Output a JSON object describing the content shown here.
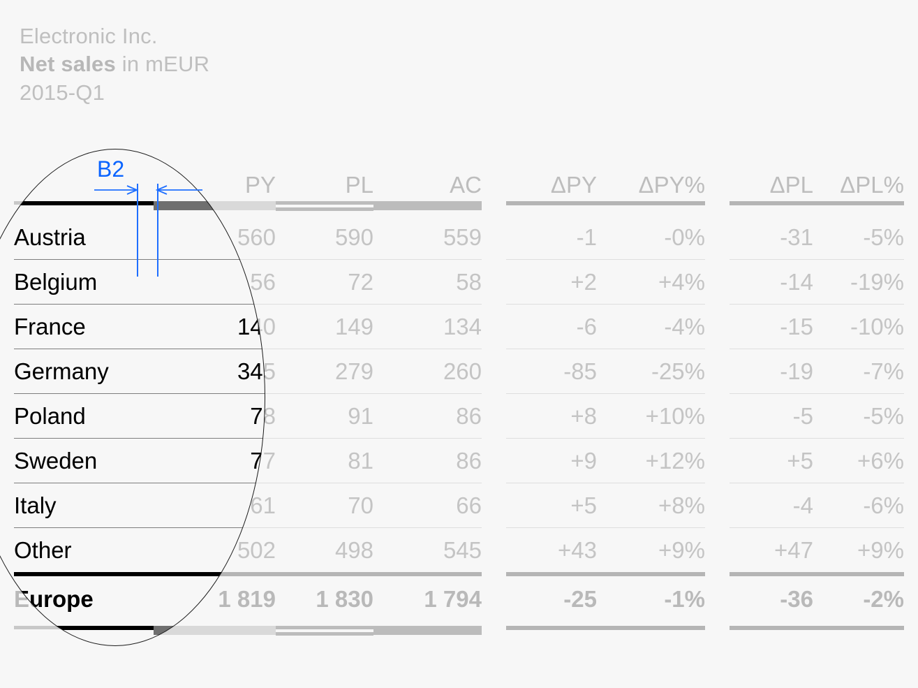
{
  "title": {
    "company": "Electronic Inc.",
    "measure_strong": "Net sales",
    "measure_rest": " in mEUR",
    "period": "2015-Q1"
  },
  "annotation": {
    "label": "B2",
    "color": "#0a64ff",
    "kind": "dimension-gap"
  },
  "table": {
    "headers": {
      "label": "",
      "py": "PY",
      "pl": "PL",
      "ac": "AC",
      "dpy": "ΔPY",
      "dpy_pct": "ΔPY%",
      "dpl": "ΔPL",
      "dpl_pct": "ΔPL%"
    },
    "rows": [
      {
        "label": "Austria",
        "py": "560",
        "pl": "590",
        "ac": "559",
        "dpy": "-1",
        "dpy_pct": "-0%",
        "dpl": "-31",
        "dpl_pct": "-5%"
      },
      {
        "label": "Belgium",
        "py": "56",
        "pl": "72",
        "ac": "58",
        "dpy": "+2",
        "dpy_pct": "+4%",
        "dpl": "-14",
        "dpl_pct": "-19%"
      },
      {
        "label": "France",
        "py": "140",
        "pl": "149",
        "ac": "134",
        "dpy": "-6",
        "dpy_pct": "-4%",
        "dpl": "-15",
        "dpl_pct": "-10%"
      },
      {
        "label": "Germany",
        "py": "345",
        "pl": "279",
        "ac": "260",
        "dpy": "-85",
        "dpy_pct": "-25%",
        "dpl": "-19",
        "dpl_pct": "-7%"
      },
      {
        "label": "Poland",
        "py": "78",
        "pl": "91",
        "ac": "86",
        "dpy": "+8",
        "dpy_pct": "+10%",
        "dpl": "-5",
        "dpl_pct": "-5%"
      },
      {
        "label": "Sweden",
        "py": "77",
        "pl": "81",
        "ac": "86",
        "dpy": "+9",
        "dpy_pct": "+12%",
        "dpl": "+5",
        "dpl_pct": "+6%"
      },
      {
        "label": "Italy",
        "py": "61",
        "pl": "70",
        "ac": "66",
        "dpy": "+5",
        "dpy_pct": "+8%",
        "dpl": "-4",
        "dpl_pct": "-6%"
      },
      {
        "label": "Other",
        "py": "502",
        "pl": "498",
        "ac": "545",
        "dpy": "+43",
        "dpy_pct": "+9%",
        "dpl": "+47",
        "dpl_pct": "+9%"
      }
    ],
    "total": {
      "label": "Europe",
      "py": "1 819",
      "pl": "1 830",
      "ac": "1 794",
      "dpy": "-25",
      "dpy_pct": "-1%",
      "dpl": "-36",
      "dpl_pct": "-2%"
    }
  },
  "chart_data": {
    "type": "table",
    "title": "Electronic Inc. — Net sales in mEUR — 2015-Q1",
    "categories": [
      "Austria",
      "Belgium",
      "France",
      "Germany",
      "Poland",
      "Sweden",
      "Italy",
      "Other",
      "Europe"
    ],
    "series": [
      {
        "name": "PY",
        "values": [
          560,
          56,
          140,
          345,
          78,
          77,
          61,
          502,
          1819
        ]
      },
      {
        "name": "PL",
        "values": [
          590,
          72,
          149,
          279,
          91,
          81,
          70,
          498,
          1830
        ]
      },
      {
        "name": "AC",
        "values": [
          559,
          58,
          134,
          260,
          86,
          86,
          66,
          545,
          1794
        ]
      },
      {
        "name": "ΔPY",
        "values": [
          -1,
          2,
          -6,
          -85,
          8,
          9,
          5,
          43,
          -25
        ]
      },
      {
        "name": "ΔPY%",
        "values": [
          0,
          4,
          -4,
          -25,
          10,
          12,
          8,
          9,
          -1
        ]
      },
      {
        "name": "ΔPL",
        "values": [
          -31,
          -14,
          -15,
          -19,
          -5,
          5,
          -4,
          47,
          -36
        ]
      },
      {
        "name": "ΔPL%",
        "values": [
          -5,
          -19,
          -10,
          -7,
          -5,
          6,
          -6,
          9,
          -2
        ]
      }
    ],
    "xlabel": "",
    "ylabel": "mEUR",
    "legend": "top"
  },
  "colors": {
    "accent_blue": "#0a64ff",
    "muted_text": "#bfbfbf",
    "dark_text": "#000000",
    "page_bg": "#f7f7f7"
  }
}
